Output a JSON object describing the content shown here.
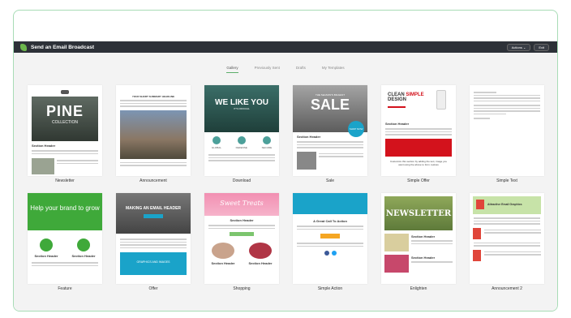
{
  "app": {
    "title": "Send an Email Broadcast",
    "actions_label": "Actions ⌄",
    "exit_label": "Exit"
  },
  "tabs": [
    {
      "label": "Gallery",
      "active": true
    },
    {
      "label": "Previously Sent",
      "active": false
    },
    {
      "label": "Drafts",
      "active": false
    },
    {
      "label": "My Templates",
      "active": false
    }
  ],
  "templates": [
    {
      "name": "Newsletter",
      "hero": "PINE",
      "sub": "COLLECTION",
      "section": "Section Header"
    },
    {
      "name": "Announcement",
      "hero": "YOUR SHORT SUMMARY HEADLINE"
    },
    {
      "name": "Download",
      "hero": "WE LIKE YOU",
      "sub": "IT'S OFFICIAL",
      "icons": [
        "GLOBAL",
        "DEFENSE",
        "SECURE"
      ]
    },
    {
      "name": "Sale",
      "hero": "SALE",
      "sub": "THE SEASON'S BIGGEST",
      "badge": "SHOP NOW",
      "section": "Section Header"
    },
    {
      "name": "Simple Offer",
      "hero_clean": "CLEAN",
      "hero_simple": "SIMPLE",
      "hero_design": "DESIGN",
      "section": "Section Header",
      "body": "Customize this section by adding the text, image you want using the above to form. testsss"
    },
    {
      "name": "Simple Text"
    },
    {
      "name": "Feature",
      "hero": "Help your brand to grow",
      "section": "Section Header"
    },
    {
      "name": "Offer",
      "hero": "MAKING AN EMAIL HEADER",
      "sub": "GRAPHICS AND IMAGES"
    },
    {
      "name": "Shopping",
      "hero": "Sweet Treats",
      "section": "Section Header"
    },
    {
      "name": "Simple Action",
      "hero": "A Great Call To Action"
    },
    {
      "name": "Enlighten",
      "hero": "NEWSLETTER",
      "section": "Section Header"
    },
    {
      "name": "Announcement 2",
      "hero": "Attractive Email Graphics"
    }
  ],
  "colors": {
    "accent": "#5cae6a",
    "topbar": "#2d3138",
    "sale_badge": "#1aa3c9",
    "offer_red": "#d3121c"
  }
}
